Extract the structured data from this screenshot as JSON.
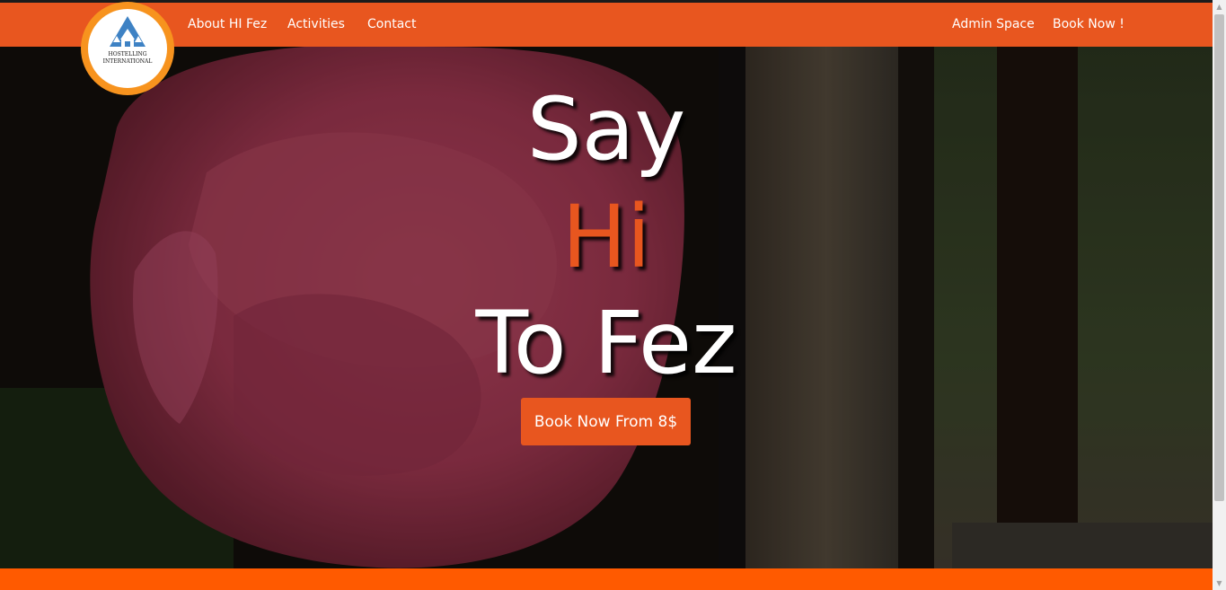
{
  "nav": {
    "left": [
      "About HI Fez",
      "Activities",
      "Contact"
    ],
    "right": [
      "Admin Space",
      "Book Now !"
    ]
  },
  "logo": {
    "line1": "HOSTELLING",
    "line2": "INTERNATIONAL"
  },
  "hero": {
    "line1": "Say",
    "line2": "Hi",
    "line3": "To Fez",
    "cta": "Book Now From 8$"
  },
  "colors": {
    "brand": "#e8561f",
    "logo_ring": "#f7931e",
    "logo_triangle": "#3e82c4"
  }
}
